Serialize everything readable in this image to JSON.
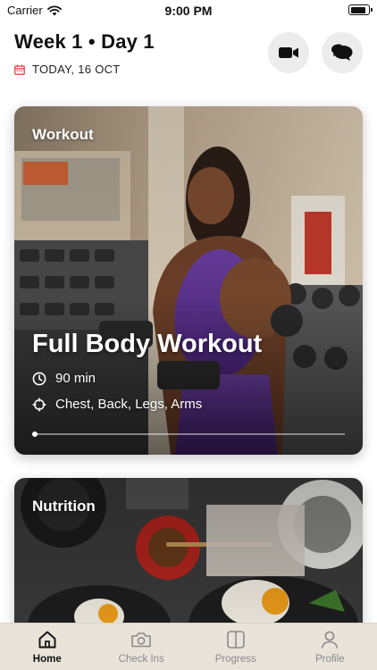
{
  "status_bar": {
    "carrier": "Carrier",
    "time": "9:00 PM",
    "battery_level": 0.95
  },
  "header": {
    "title": "Week 1 • Day 1",
    "date": "TODAY, 16 OCT",
    "calendar_icon": "calendar-icon",
    "video_icon": "video-camera-icon",
    "chat_icon": "chat-bubbles-icon"
  },
  "workout_card": {
    "label": "Workout",
    "title": "Full Body Workout",
    "duration": "90 min",
    "focus": "Chest, Back, Legs, Arms",
    "progress": 0.0
  },
  "nutrition_card": {
    "label": "Nutrition"
  },
  "tabs": [
    {
      "label": "Home",
      "icon": "home-icon",
      "active": true
    },
    {
      "label": "Check Ins",
      "icon": "camera-icon",
      "active": false
    },
    {
      "label": "Progress",
      "icon": "split-square-icon",
      "active": false
    },
    {
      "label": "Profile",
      "icon": "person-icon",
      "active": false
    }
  ],
  "colors": {
    "accent": "#e0454a",
    "tab_bar_bg": "#e9e3da",
    "header_button_bg": "#ececec"
  }
}
